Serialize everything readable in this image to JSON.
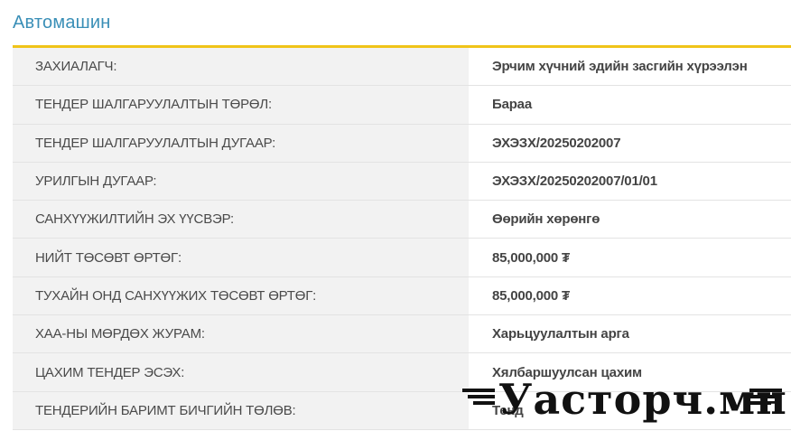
{
  "section": {
    "title": "Автомашин"
  },
  "details": [
    {
      "label": "ЗАХИАЛАГЧ:",
      "value": "Эрчим хүчний эдийн засгийн хүрээлэн"
    },
    {
      "label": "ТЕНДЕР ШАЛГАРУУЛАЛТЫН ТӨРӨЛ:",
      "value": "Бараа"
    },
    {
      "label": "ТЕНДЕР ШАЛГАРУУЛАЛТЫН ДУГААР:",
      "value": "ЭХЭЗХ/20250202007"
    },
    {
      "label": "УРИЛГЫН ДУГААР:",
      "value": "ЭХЭЗХ/20250202007/01/01"
    },
    {
      "label": "САНХҮҮЖИЛТИЙН ЭХ ҮҮСВЭР:",
      "value": "Өөрийн хөрөнгө"
    },
    {
      "label": "НИЙТ ТӨСӨВТ ӨРТӨГ:",
      "value": "85,000,000 ₮"
    },
    {
      "label": "ТУХАЙН ОНД САНХҮҮЖИХ ТӨСӨВТ ӨРТӨГ:",
      "value": "85,000,000 ₮"
    },
    {
      "label": "ХАА-НЫ МӨРДӨХ ЖУРАМ:",
      "value": "Харьцуулалтын арга"
    },
    {
      "label": "ЦАХИМ ТЕНДЕР ЭСЭХ:",
      "value": "Хялбаршуулсан цахим"
    },
    {
      "label": "ТЕНДЕРИЙН БАРИМТ БИЧГИЙН ТӨЛӨВ:",
      "value": "Тенд"
    }
  ],
  "watermark": {
    "text": "Уасторч.мн"
  },
  "colors": {
    "title": "#3a8fb7",
    "accent": "#f0c419",
    "label_bg": "#f2f2f2"
  }
}
